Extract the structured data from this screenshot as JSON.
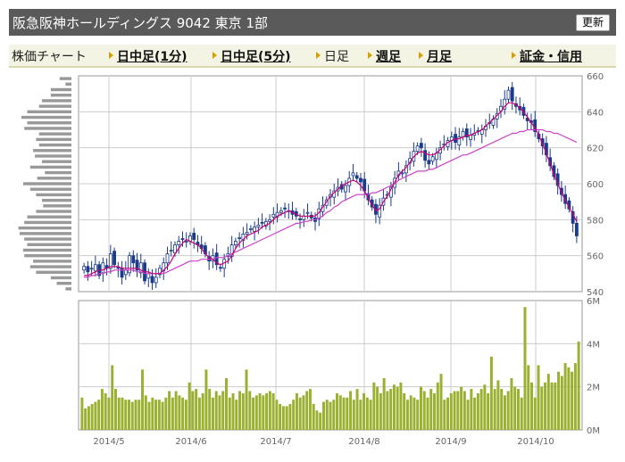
{
  "header": {
    "title": "阪急阪神ホールディングス 9042 東京 1部",
    "refresh_label": "更新"
  },
  "nav": {
    "label": "株価チャート",
    "items": [
      {
        "label": "日中足(1分)",
        "active": false
      },
      {
        "label": "日中足(5分)",
        "active": false
      },
      {
        "label": "日足",
        "active": true
      },
      {
        "label": "週足",
        "active": false
      },
      {
        "label": "月足",
        "active": false
      },
      {
        "label": "証金・信用",
        "active": false
      }
    ]
  },
  "colors": {
    "candle_up": "#1a3a8a",
    "candle_down": "#1a3a8a",
    "ma_short": "#cc0077",
    "ma_long": "#cc44cc",
    "volume": "#9ab030",
    "volume_profile": "#999999",
    "grid": "#cccccc"
  },
  "chart_data": [
    {
      "type": "candlestick",
      "title": "",
      "ylim": [
        540,
        660
      ],
      "y_ticks": [
        "540",
        "560",
        "580",
        "600",
        "620",
        "640",
        "660"
      ],
      "x_ticks": [
        "2014/5",
        "2014/6",
        "2014/7",
        "2014/8",
        "2014/9",
        "2014/10"
      ],
      "close": [
        554,
        551,
        553,
        555,
        549,
        556,
        553,
        561,
        555,
        553,
        548,
        552,
        560,
        556,
        552,
        556,
        546,
        550,
        545,
        548,
        553,
        556,
        561,
        563,
        566,
        568,
        569,
        568,
        571,
        569,
        566,
        564,
        561,
        557,
        560,
        555,
        553,
        558,
        561,
        566,
        568,
        570,
        572,
        573,
        575,
        576,
        577,
        578,
        579,
        580,
        583,
        584,
        585,
        586,
        585,
        583,
        582,
        580,
        582,
        584,
        581,
        579,
        586,
        588,
        591,
        594,
        596,
        598,
        597,
        599,
        603,
        606,
        603,
        601,
        596,
        591,
        587,
        583,
        588,
        592,
        594,
        598,
        603,
        607,
        606,
        610,
        614,
        618,
        621,
        620,
        613,
        611,
        615,
        617,
        620,
        622,
        624,
        626,
        623,
        626,
        629,
        626,
        627,
        628,
        629,
        630,
        632,
        634,
        636,
        639,
        643,
        647,
        652,
        646,
        643,
        641,
        638,
        635,
        634,
        629,
        625,
        621,
        616,
        610,
        604,
        599,
        594,
        589,
        586,
        578,
        571
      ],
      "ma_short": [
        549,
        549,
        550,
        551,
        552,
        552,
        553,
        554,
        554,
        554,
        553,
        553,
        553,
        553,
        553,
        552,
        551,
        551,
        550,
        550,
        550,
        552,
        554,
        557,
        561,
        564,
        567,
        569,
        568,
        567,
        566,
        564,
        561,
        559,
        558,
        556,
        555,
        556,
        557,
        560,
        564,
        567,
        569,
        571,
        572,
        573,
        574,
        576,
        577,
        578,
        580,
        582,
        583,
        584,
        585,
        584,
        583,
        582,
        582,
        582,
        582,
        582,
        584,
        587,
        590,
        593,
        595,
        597,
        599,
        600,
        601,
        602,
        601,
        599,
        596,
        592,
        588,
        585,
        586,
        590,
        593,
        597,
        601,
        605,
        607,
        609,
        612,
        615,
        617,
        618,
        617,
        616,
        616,
        617,
        619,
        621,
        623,
        624,
        625,
        625,
        626,
        627,
        627,
        628,
        629,
        630,
        632,
        634,
        636,
        638,
        640,
        643,
        645,
        645,
        644,
        642,
        640,
        637,
        634,
        631,
        627,
        622,
        617,
        611,
        605,
        600,
        595,
        591,
        587,
        583,
        579
      ],
      "ma_long": [
        548,
        548,
        549,
        549,
        550,
        550,
        551,
        551,
        552,
        552,
        552,
        552,
        552,
        552,
        551,
        551,
        550,
        550,
        550,
        550,
        550,
        550,
        551,
        552,
        553,
        554,
        555,
        556,
        557,
        557,
        557,
        558,
        558,
        558,
        558,
        559,
        559,
        559,
        560,
        561,
        562,
        563,
        564,
        565,
        566,
        567,
        568,
        569,
        570,
        571,
        572,
        573,
        574,
        575,
        576,
        577,
        578,
        578,
        579,
        579,
        580,
        580,
        581,
        582,
        584,
        585,
        587,
        588,
        590,
        591,
        592,
        593,
        594,
        594,
        594,
        594,
        595,
        595,
        596,
        597,
        598,
        599,
        600,
        602,
        603,
        604,
        605,
        606,
        607,
        607,
        607,
        608,
        608,
        609,
        610,
        611,
        612,
        613,
        614,
        615,
        616,
        616,
        617,
        618,
        619,
        620,
        621,
        622,
        623,
        624,
        625,
        626,
        627,
        628,
        628,
        629,
        629,
        630,
        630,
        630,
        630,
        630,
        629,
        629,
        628,
        628,
        627,
        626,
        625,
        624,
        623
      ],
      "volume_profile": [
        0.2,
        0.1,
        0.35,
        0.35,
        0.5,
        0.55,
        0.75,
        0.85,
        0.75,
        0.8,
        0.55,
        0.6,
        0.55,
        0.65,
        0.62,
        0.5,
        0.7,
        0.45,
        0.58,
        0.82,
        0.7,
        0.6,
        0.5,
        0.48,
        0.6,
        0.75,
        0.8,
        0.9,
        0.88,
        0.8,
        0.75,
        0.82,
        0.8,
        0.65,
        0.7,
        0.6,
        0.35,
        0.25,
        0.1
      ]
    },
    {
      "type": "bar",
      "title": "",
      "ylabel": "",
      "ylim": [
        0,
        6000000
      ],
      "y_ticks": [
        "0M",
        "2M",
        "4M",
        "6M"
      ],
      "values": [
        1500000,
        1000000,
        1100000,
        1200000,
        1300000,
        1400000,
        1900000,
        1700000,
        1500000,
        3000000,
        1900000,
        1500000,
        1500000,
        1400000,
        1400000,
        1300000,
        1400000,
        1400000,
        2800000,
        1600000,
        1300000,
        1500000,
        1400000,
        1400000,
        1300000,
        1500000,
        1800000,
        1500000,
        1800000,
        1600000,
        1500000,
        1400000,
        2200000,
        1800000,
        1900000,
        1500000,
        1700000,
        2800000,
        1900000,
        1500000,
        1800000,
        1600000,
        1800000,
        2400000,
        1500000,
        1700000,
        1400000,
        1800000,
        1700000,
        2800000,
        1800000,
        1500000,
        1600000,
        1700000,
        1600000,
        1700000,
        1800000,
        1700000,
        1400000,
        1200000,
        1100000,
        1100000,
        1200000,
        1400000,
        1700000,
        1500000,
        1600000,
        1800000,
        1900000,
        1200000,
        900000,
        800000,
        1300000,
        1400000,
        1300000,
        1400000,
        1700000,
        1600000,
        1500000,
        1500000,
        1800000,
        1400000,
        1900000,
        1400000,
        1700000,
        1500000,
        1400000,
        2200000,
        2000000,
        1700000,
        2400000,
        1800000,
        1900000,
        2100000,
        2000000,
        2200000,
        1700000,
        1400000,
        1600000,
        1500000,
        1400000,
        2000000,
        1800000,
        1500000,
        1900000,
        1700000,
        2200000,
        2600000,
        1400000,
        1500000,
        1700000,
        1800000,
        1800000,
        2000000,
        1800000,
        1400000,
        1900000,
        1500000,
        1700000,
        1900000,
        2100000,
        1700000,
        3400000,
        1900000,
        2300000,
        1900000,
        1600000,
        1800000,
        2400000,
        2000000,
        1900000,
        1500000,
        5700000,
        3000000,
        2200000,
        1500000,
        3000000,
        2000000,
        2200000,
        2600000,
        2200000,
        2200000,
        2700000,
        2500000,
        3100000,
        2900000,
        2700000,
        3100000,
        4100000
      ]
    }
  ]
}
